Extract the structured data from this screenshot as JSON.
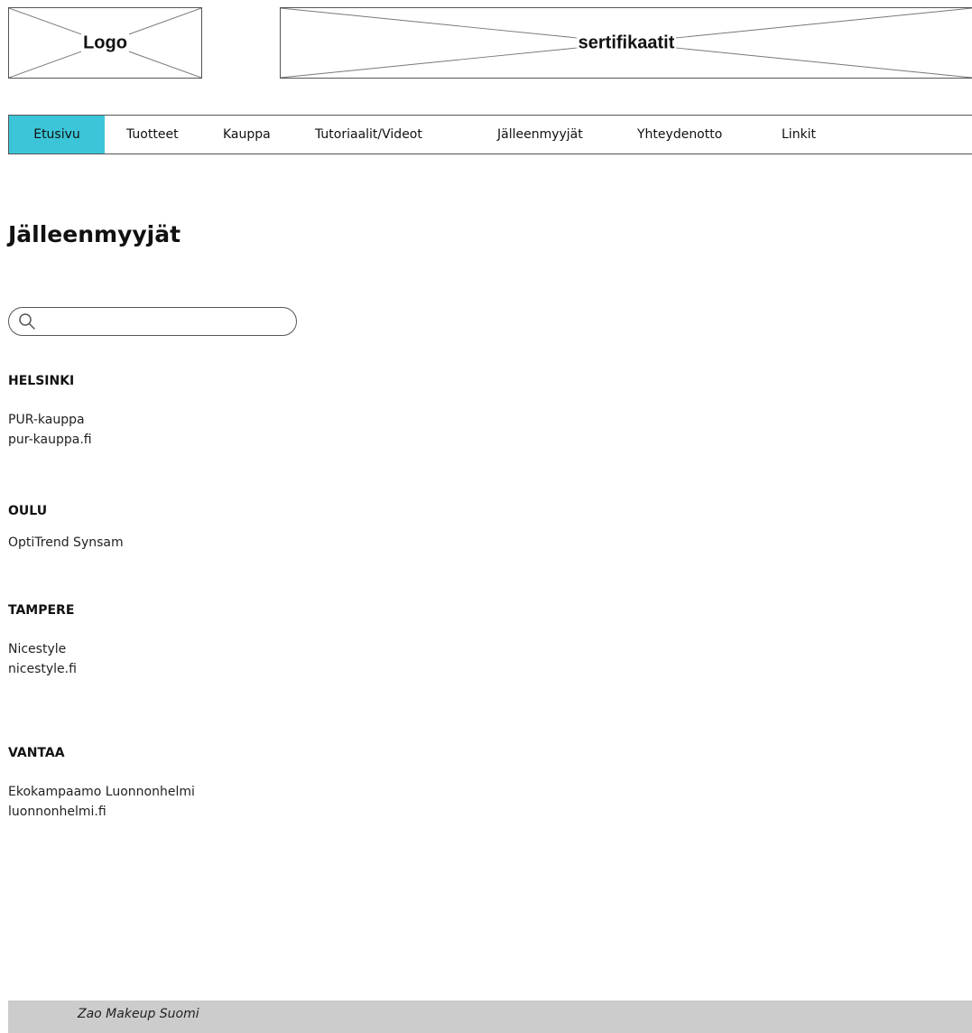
{
  "header": {
    "logo_label": "Logo",
    "banner_label": "sertifikaatit"
  },
  "nav": {
    "items": [
      {
        "label": "Etusivu",
        "active": true
      },
      {
        "label": "Tuotteet",
        "active": false
      },
      {
        "label": "Kauppa",
        "active": false
      },
      {
        "label": "Tutoriaalit/Videot",
        "active": false
      },
      {
        "label": "Jälleenmyyjät",
        "active": false
      },
      {
        "label": "Yhteydenotto",
        "active": false
      },
      {
        "label": "Linkit",
        "active": false
      }
    ],
    "active_color": "#3cc5d8"
  },
  "page": {
    "title": "Jälleenmyyjät"
  },
  "search": {
    "value": "",
    "placeholder": "",
    "icon": "search-icon"
  },
  "retailers": [
    {
      "city": "HELSINKI",
      "lines": [
        "PUR-kauppa",
        "pur-kauppa.fi"
      ]
    },
    {
      "city": "OULU",
      "lines": [
        "OptiTrend Synsam"
      ]
    },
    {
      "city": "TAMPERE",
      "lines": [
        "Nicestyle",
        "nicestyle.fi"
      ]
    },
    {
      "city": "VANTAA",
      "lines": [
        "Ekokampaamo Luonnonhelmi",
        "luonnonhelmi.fi"
      ]
    }
  ],
  "footer": {
    "text": "Zao Makeup Suomi",
    "background": "#cccccc"
  }
}
